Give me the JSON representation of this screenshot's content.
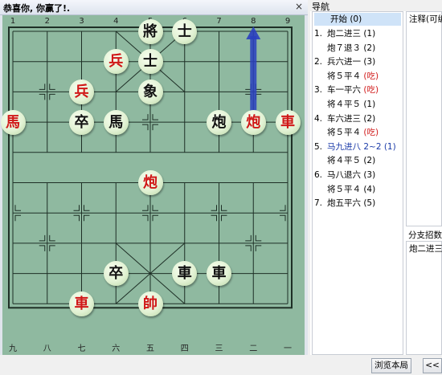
{
  "board_window": {
    "title": "恭喜你, 你赢了!.",
    "close": "×"
  },
  "file_labels_top": [
    "1",
    "2",
    "3",
    "4",
    "5",
    "6",
    "7",
    "8",
    "9"
  ],
  "file_labels_bottom": [
    "九",
    "八",
    "七",
    "六",
    "五",
    "四",
    "三",
    "二",
    "一"
  ],
  "pieces": [
    {
      "char": "將",
      "side": "black",
      "file": 4,
      "rank": 0
    },
    {
      "char": "士",
      "side": "black",
      "file": 5,
      "rank": 0
    },
    {
      "char": "兵",
      "side": "red",
      "file": 3,
      "rank": 1
    },
    {
      "char": "士",
      "side": "black",
      "file": 4,
      "rank": 1
    },
    {
      "char": "兵",
      "side": "red",
      "file": 2,
      "rank": 2
    },
    {
      "char": "象",
      "side": "black",
      "file": 4,
      "rank": 2
    },
    {
      "char": "馬",
      "side": "red",
      "file": 0,
      "rank": 3
    },
    {
      "char": "卒",
      "side": "black",
      "file": 2,
      "rank": 3
    },
    {
      "char": "馬",
      "side": "black",
      "file": 3,
      "rank": 3
    },
    {
      "char": "炮",
      "side": "black",
      "file": 6,
      "rank": 3
    },
    {
      "char": "炮",
      "side": "red",
      "file": 7,
      "rank": 3
    },
    {
      "char": "車",
      "side": "red",
      "file": 8,
      "rank": 3
    },
    {
      "char": "炮",
      "side": "red",
      "file": 4,
      "rank": 5
    },
    {
      "char": "卒",
      "side": "black",
      "file": 3,
      "rank": 8
    },
    {
      "char": "車",
      "side": "black",
      "file": 5,
      "rank": 8
    },
    {
      "char": "車",
      "side": "black",
      "file": 6,
      "rank": 8
    },
    {
      "char": "車",
      "side": "red",
      "file": 2,
      "rank": 9
    },
    {
      "char": "帥",
      "side": "red",
      "file": 4,
      "rank": 9
    }
  ],
  "last_move_arrow": {
    "from": {
      "file": 7,
      "rank": 3
    },
    "to": {
      "file": 7,
      "rank": 0
    },
    "color": "#2a3fbf"
  },
  "navigation": {
    "title": "导航",
    "start": "开始 (0)",
    "moves": [
      {
        "num": "1.",
        "text": "炮二进三 (1)",
        "style": "normal"
      },
      {
        "num": "",
        "text": "炮７退３ (2)",
        "style": "normal"
      },
      {
        "num": "2.",
        "text": "兵六进一 (3)",
        "style": "normal"
      },
      {
        "num": "",
        "text": "将５平４ ",
        "cap": "(吃)",
        "style": "normal"
      },
      {
        "num": "3.",
        "text": "车一平六 ",
        "cap": "(吃)",
        "style": "normal"
      },
      {
        "num": "",
        "text": "将４平５ (1)",
        "style": "normal"
      },
      {
        "num": "4.",
        "text": "车六进三 (2)",
        "style": "normal"
      },
      {
        "num": "",
        "text": "将５平４ ",
        "cap": "(吃)",
        "style": "normal"
      },
      {
        "num": "5.",
        "text": "马九进八 2~2 (1)",
        "style": "blue"
      },
      {
        "num": "",
        "text": "将４平５ (2)",
        "style": "normal"
      },
      {
        "num": "6.",
        "text": "马八退六 (3)",
        "style": "normal"
      },
      {
        "num": "",
        "text": "将５平４ (4)",
        "style": "normal"
      },
      {
        "num": "7.",
        "text": "炮五平六 (5)",
        "style": "normal"
      }
    ]
  },
  "comment_label": "注释(可编",
  "branch": {
    "label": "分支招数",
    "value": "炮二进三"
  },
  "buttons": {
    "browse": "浏览本局",
    "prev": "<<"
  },
  "colors": {
    "board": "#8fb9a0",
    "grid": "#1e2f26",
    "red": "#d01818"
  }
}
